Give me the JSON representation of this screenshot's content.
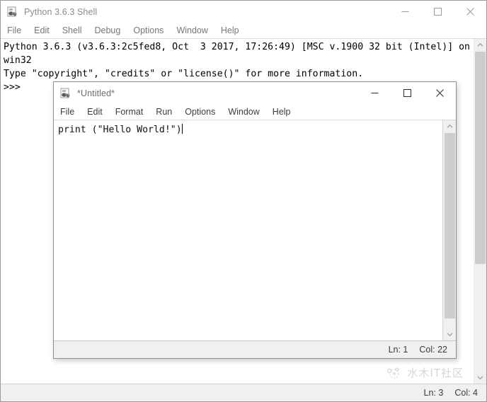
{
  "shell_window": {
    "title": "Python 3.6.3 Shell",
    "icon": "python-icon",
    "menu": [
      {
        "label": "File"
      },
      {
        "label": "Edit"
      },
      {
        "label": "Shell"
      },
      {
        "label": "Debug"
      },
      {
        "label": "Options"
      },
      {
        "label": "Window"
      },
      {
        "label": "Help"
      }
    ],
    "window_controls": {
      "minimize": "minimize-icon",
      "maximize": "maximize-icon",
      "close": "close-icon"
    },
    "output": {
      "line1": "Python 3.6.3 (v3.6.3:2c5fed8, Oct  3 2017, 17:26:49) [MSC v.1900 32 bit (Intel)] on win32",
      "line2": "Type \"copyright\", \"credits\" or \"license()\" for more information.",
      "line3": ">>> "
    },
    "status": {
      "line": "Ln: 3",
      "col": "Col: 4"
    },
    "scrollbar": {
      "up_arrow": "chevron-up-icon",
      "down_arrow": "chevron-down-icon"
    }
  },
  "editor_window": {
    "title": "*Untitled*",
    "icon": "python-icon",
    "menu": [
      {
        "label": "File"
      },
      {
        "label": "Edit"
      },
      {
        "label": "Format"
      },
      {
        "label": "Run"
      },
      {
        "label": "Options"
      },
      {
        "label": "Window"
      },
      {
        "label": "Help"
      }
    ],
    "window_controls": {
      "minimize": "minimize-icon",
      "maximize": "maximize-icon",
      "close": "close-icon"
    },
    "code": "print (\"Hello World!\")",
    "status": {
      "line": "Ln: 1",
      "col": "Col: 22"
    },
    "scrollbar": {
      "up_arrow": "chevron-up-icon",
      "down_arrow": "chevron-down-icon"
    }
  },
  "watermark": {
    "text": "水木IT社区",
    "logo": "community-logo-icon"
  },
  "colors": {
    "window_border": "#9a9a9a",
    "menu_text_inactive": "#777777",
    "menu_text_active": "#3d3d3d",
    "title_text": "#8c8c8c",
    "status_bg": "#f0f0f0",
    "scroll_track": "#f0f0f0",
    "scroll_thumb": "#cdcdcd",
    "code_text": "#111111"
  }
}
